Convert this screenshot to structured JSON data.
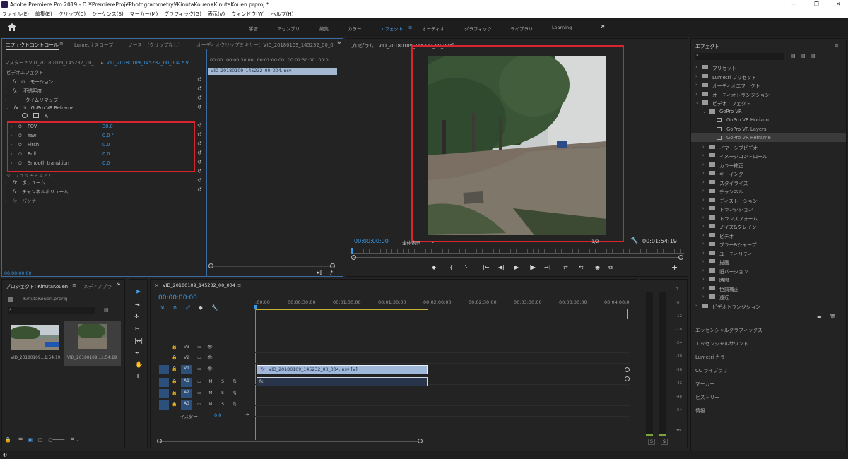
{
  "window": {
    "title": "Adobe Premiere Pro 2019 - D:¥PremiereProj¥Photogrammetry¥KinutaKouen¥KinutaKouen.prproj *",
    "controls": [
      "—",
      "❐",
      "✕"
    ]
  },
  "menu": [
    "ファイル(E)",
    "編集(E)",
    "クリップ(C)",
    "シーケンス(S)",
    "マーカー(M)",
    "グラフィック(G)",
    "表示(V)",
    "ウィンドウ(W)",
    "ヘルプ(H)"
  ],
  "workspaces": {
    "items": [
      "学習",
      "アセンブリ",
      "編集",
      "カラー",
      "エフェクト",
      "オーディオ",
      "グラフィック",
      "ライブラリ",
      "Learning"
    ],
    "active": "エフェクト",
    "more": "»"
  },
  "effect_controls": {
    "tabs": [
      "エフェクトコントロール",
      "Lumetri スコープ",
      "ソース：（クリップなし）",
      "オーディオクリップミキサー：VID_20180109_145232_00_0"
    ],
    "master": "マスター * VID_20180109_145232_00_...",
    "clip": "VID_20180109_145232_00_004 * V...",
    "section": "ビデオエフェクト",
    "effects": [
      {
        "fx": "fx",
        "name": "モーション"
      },
      {
        "fx": "fx",
        "name": "不透明度"
      },
      {
        "fx": "",
        "name": "タイムリマップ"
      },
      {
        "fx": "fx",
        "name": "GoPro VR Reframe"
      }
    ],
    "params": [
      {
        "name": "FOV",
        "value": "30.0"
      },
      {
        "name": "Yaw",
        "value": "0.0 °"
      },
      {
        "name": "Pitch",
        "value": "0.0"
      },
      {
        "name": "Roll",
        "value": "0.0"
      },
      {
        "name": "Smooth transition",
        "value": "0.0"
      }
    ],
    "audio_section": "オーディオエフェクト",
    "audio_effects": [
      {
        "name": "ボリューム"
      },
      {
        "name": "チャンネルボリューム"
      },
      {
        "name": "パンナー"
      }
    ],
    "timecode": "00:00:00:00",
    "ruler": [
      "00:00",
      "00:00:30:00",
      "00:01:00:00",
      "00:01:30:00",
      "00:0"
    ],
    "clipbar": "VID_20180109_145232_00_004.insv"
  },
  "program": {
    "title": "プログラム：VID_20180109_145232_00_004",
    "menu": "≡",
    "timecode": "00:00:00:00",
    "fit": "全体表示",
    "quality": "1/2",
    "duration": "00:01:54:19",
    "transport": [
      "◆",
      "{",
      "}",
      "|←",
      "◀|",
      "▶",
      "|▶",
      "→|",
      "⇄",
      "⇆",
      "◉",
      "⧉"
    ]
  },
  "project": {
    "tabs": [
      "プロジェクト: KinutaKouen",
      "メディアブラ"
    ],
    "file": "KinutaKouen.prproj",
    "items": [
      {
        "name": "VID_20180109...",
        "dur": "1:54:19"
      },
      {
        "name": "VID_20180109...",
        "dur": "1:54:19"
      }
    ]
  },
  "timeline": {
    "tab": "VID_20180109_145232_00_004",
    "timecode": "00:00:00:00",
    "ruler": [
      ":00:00",
      "00:00:30:00",
      "00:01:00:00",
      "00:01:30:00",
      "00:02:00:00",
      "00:02:30:00",
      "00:03:00:00",
      "00:03:30:00",
      "00:04:00:0"
    ],
    "tracks": [
      {
        "name": "V3"
      },
      {
        "name": "V2"
      },
      {
        "name": "V1"
      },
      {
        "name": "A1"
      },
      {
        "name": "A2"
      },
      {
        "name": "A3"
      }
    ],
    "master": "マスター",
    "master_val": "0.0",
    "clip": "VID_20180109_145232_00_004.insv [V]"
  },
  "meter": {
    "scale": [
      "0",
      "-6",
      "-12",
      "-18",
      "-24",
      "-30",
      "-36",
      "-42",
      "-48",
      "-54",
      "dB"
    ],
    "solo": [
      "S",
      "S"
    ]
  },
  "effects_panel": {
    "title": "エフェクト",
    "tree": [
      {
        "label": "プリセット",
        "level": 0
      },
      {
        "label": "Lumetri プリセット",
        "level": 0
      },
      {
        "label": "オーディオエフェクト",
        "level": 0
      },
      {
        "label": "オーディオトランジション",
        "level": 0
      },
      {
        "label": "ビデオエフェクト",
        "level": 0,
        "open": true
      },
      {
        "label": "GoPro VR",
        "level": 1,
        "open": true
      },
      {
        "label": "GoPro VR Horizon",
        "level": 2
      },
      {
        "label": "GoPro VR Layers",
        "level": 2
      },
      {
        "label": "GoPro VR Reframe",
        "level": 2,
        "selected": true
      },
      {
        "label": "イマーシブビデオ",
        "level": 1
      },
      {
        "label": "イメージコントロール",
        "level": 1
      },
      {
        "label": "カラー補正",
        "level": 1
      },
      {
        "label": "キーイング",
        "level": 1
      },
      {
        "label": "スタイライズ",
        "level": 1
      },
      {
        "label": "チャンネル",
        "level": 1
      },
      {
        "label": "ディストーション",
        "level": 1
      },
      {
        "label": "トランジション",
        "level": 1
      },
      {
        "label": "トランスフォーム",
        "level": 1
      },
      {
        "label": "ノイズ&グレイン",
        "level": 1
      },
      {
        "label": "ビデオ",
        "level": 1
      },
      {
        "label": "ブラー&シャープ",
        "level": 1
      },
      {
        "label": "ユーティリティ",
        "level": 1
      },
      {
        "label": "描画",
        "level": 1
      },
      {
        "label": "旧バージョン",
        "level": 1
      },
      {
        "label": "時間",
        "level": 1
      },
      {
        "label": "色調補正",
        "level": 1
      },
      {
        "label": "遠近",
        "level": 1
      },
      {
        "label": "ビデオトランジション",
        "level": 0
      }
    ],
    "sections": [
      "エッセンシャルグラフィックス",
      "エッセンシャルサウンド",
      "Lumetri カラー",
      "CC ライブラリ",
      "マーカー",
      "ヒストリー",
      "情報"
    ]
  }
}
